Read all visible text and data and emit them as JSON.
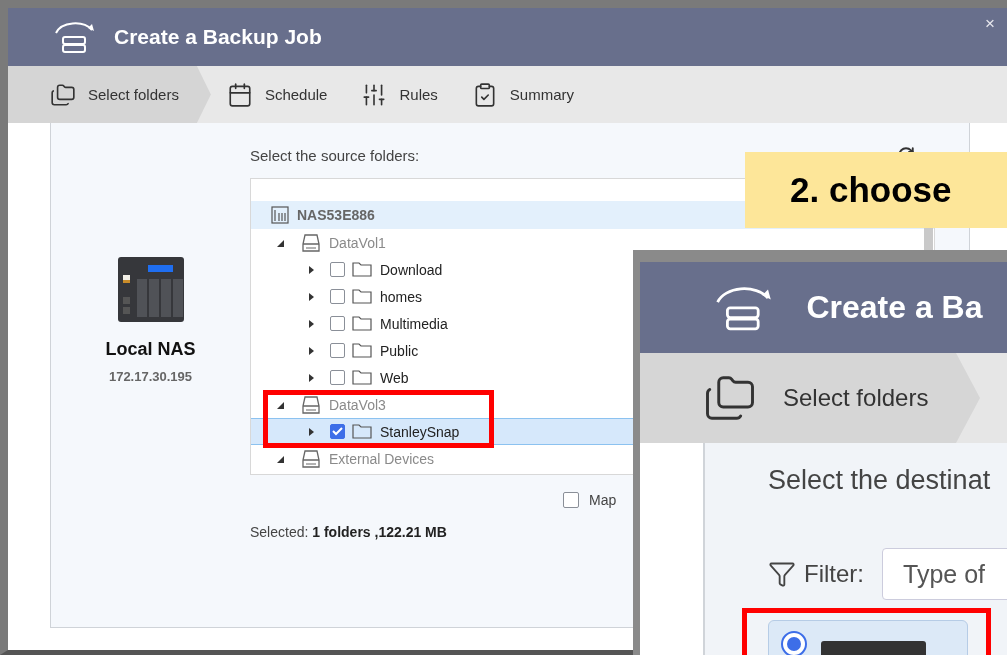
{
  "window": {
    "title": "Create a Backup Job",
    "close": "×"
  },
  "steps": [
    {
      "label": "Select folders",
      "selected": true
    },
    {
      "label": "Schedule",
      "selected": false
    },
    {
      "label": "Rules",
      "selected": false
    },
    {
      "label": "Summary",
      "selected": false
    }
  ],
  "source": {
    "device_name": "Local NAS",
    "device_ip": "172.17.30.195",
    "prompt": "Select the source folders:",
    "tree": {
      "label": "NAS53E886",
      "kind": "nas",
      "selected": false,
      "children": [
        {
          "label": "DataVol1",
          "kind": "volume",
          "expanded": true,
          "selected": false,
          "children": [
            {
              "label": "Download",
              "kind": "folder",
              "expanded": false,
              "checked": false,
              "selected": false
            },
            {
              "label": "homes",
              "kind": "folder",
              "expanded": false,
              "checked": false,
              "selected": false
            },
            {
              "label": "Multimedia",
              "kind": "folder",
              "expanded": false,
              "checked": false,
              "selected": false
            },
            {
              "label": "Public",
              "kind": "folder",
              "expanded": false,
              "checked": false,
              "selected": false
            },
            {
              "label": "Web",
              "kind": "folder",
              "expanded": false,
              "checked": false,
              "selected": false
            }
          ]
        },
        {
          "label": "DataVol3",
          "kind": "volume",
          "expanded": true,
          "selected": false,
          "children": [
            {
              "label": "StanleySnap",
              "kind": "folder",
              "expanded": false,
              "checked": true,
              "selected": true
            }
          ]
        },
        {
          "label": "External Devices",
          "kind": "volume",
          "expanded": true,
          "selected": false
        }
      ]
    },
    "map_option": {
      "label": "Map",
      "checked": false
    },
    "summary": "Selected: **1 folders ,122.21 MB**"
  },
  "callout": {
    "text": "2. choose"
  },
  "inset_window": {
    "title": "Create a Ba",
    "steps": [
      {
        "label": "Select folders",
        "selected": true
      }
    ],
    "prompt": "Select the destinat",
    "filter": {
      "label": "Filter:",
      "placeholder": "Type of"
    },
    "options": [
      {
        "selected": true
      }
    ]
  }
}
